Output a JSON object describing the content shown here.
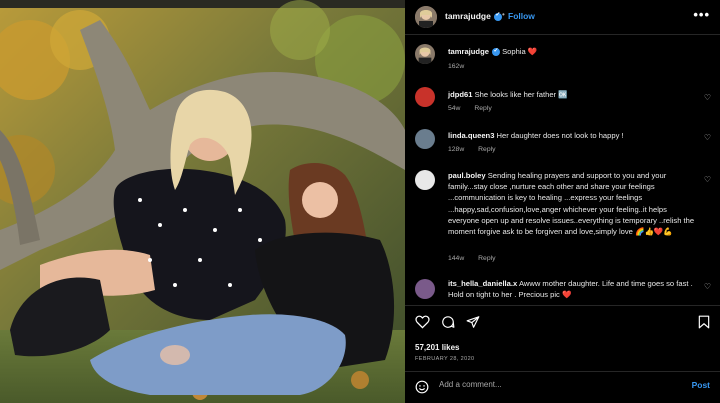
{
  "post": {
    "username": "tamrajudge",
    "follow_label": "Follow",
    "dot": "•",
    "more": "•••",
    "caption_user": "tamrajudge",
    "caption_text": "Sophia",
    "caption_emoji": "❤️",
    "caption_time": "162w"
  },
  "comments": [
    {
      "user": "jdpd61",
      "text": "She looks like her father",
      "emoji": "🆗",
      "time": "54w",
      "reply": "Reply",
      "avatar_color": "#c8322a"
    },
    {
      "user": "linda.queen3",
      "text": "Her daughter does not look to happy !",
      "time": "128w",
      "reply": "Reply",
      "avatar_color": "#6a7d8e"
    },
    {
      "user": "paul.boley",
      "text": "Sending healing prayers and support to you and your family...stay close ,nurture each other and share your feelings ...communication is key to healing ...express your feelings ...happy,sad,confusion,love,anger whichever your feeling..it helps everyone open up and resolve issues..everything is temporary ..relish the moment forgive ask to be forgiven and love,simply love",
      "emoji": "🌈👍❤️💪",
      "time": "144w",
      "reply": "Reply",
      "avatar_color": "#e8e8e8"
    },
    {
      "user": "its_hella_daniella.x",
      "text": "Awww mother daughter. Life and time goes so fast . Hold on tight to her . Precious pic",
      "emoji": "❤️",
      "time": "",
      "reply": "",
      "avatar_color": "#7a5a8a"
    }
  ],
  "actions": {
    "likes": "57,201 likes",
    "date": "FEBRUARY 28, 2020",
    "add_comment_placeholder": "Add a comment...",
    "post_label": "Post"
  },
  "colors": {
    "accent": "#3897f0",
    "background": "#000000"
  }
}
